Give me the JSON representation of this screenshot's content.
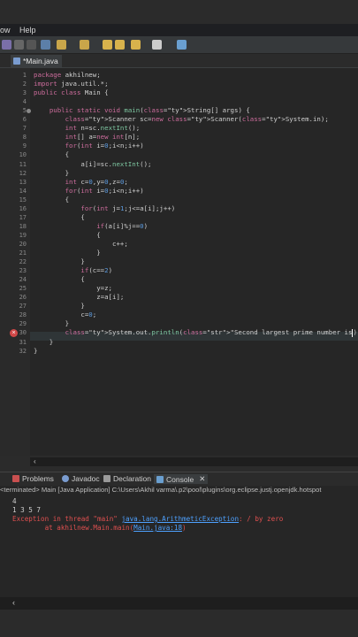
{
  "menu": {
    "items": [
      "ow",
      "Help"
    ]
  },
  "editor": {
    "tab_label": "*Main.java",
    "line_numbers": [
      "1",
      "2",
      "3",
      "4",
      "5",
      "6",
      "7",
      "8",
      "9",
      "10",
      "11",
      "12",
      "13",
      "14",
      "15",
      "16",
      "17",
      "18",
      "19",
      "20",
      "21",
      "22",
      "23",
      "24",
      "25",
      "26",
      "27",
      "28",
      "29",
      "30",
      "31",
      "32"
    ],
    "lines": [
      "package akhilnew;",
      "import java.util.*;",
      "public class Main {",
      "",
      "    public static void main(String[] args) {",
      "        Scanner sc=new Scanner(System.in);",
      "        int n=sc.nextInt();",
      "        int[] a=new int[n];",
      "        for(int i=0;i<n;i++)",
      "        {",
      "            a[i]=sc.nextInt();",
      "        }",
      "        int c=0,y=0,z=0;",
      "        for(int i=0;i<n;i++)",
      "        {",
      "            for(int j=1;j<=a[i];j++)",
      "            {",
      "                if(a[i]%j==0)",
      "                {",
      "                    c++;",
      "                }",
      "            }",
      "            if(c==2)",
      "            {",
      "                y=z;",
      "                z=a[i];",
      "            }",
      "            c=0;",
      "        }",
      "        System.out.println(\"Second largest prime number is",
      "    }",
      "}"
    ]
  },
  "console": {
    "tabs": [
      "Problems",
      "Javadoc",
      "Declaration",
      "Console"
    ],
    "terminated": "<terminated> Main [Java Application] C:\\Users\\Akhil varma\\.p2\\pool\\plugins\\org.eclipse.justj.openjdk.hotspot",
    "output": [
      "4",
      "1 3 5 7"
    ],
    "exception_prefix": "Exception in thread \"main\"",
    "exception_class": "java.lang.ArithmeticException",
    "exception_msg": ": / by zero",
    "trace_prefix": "        at akhilnew.Main.main(",
    "trace_link": "Main.java:18",
    "trace_suffix": ")"
  },
  "colors": {
    "accent": "#4ea1ff",
    "error": "#e05050",
    "keyword": "#cc6c9c"
  }
}
